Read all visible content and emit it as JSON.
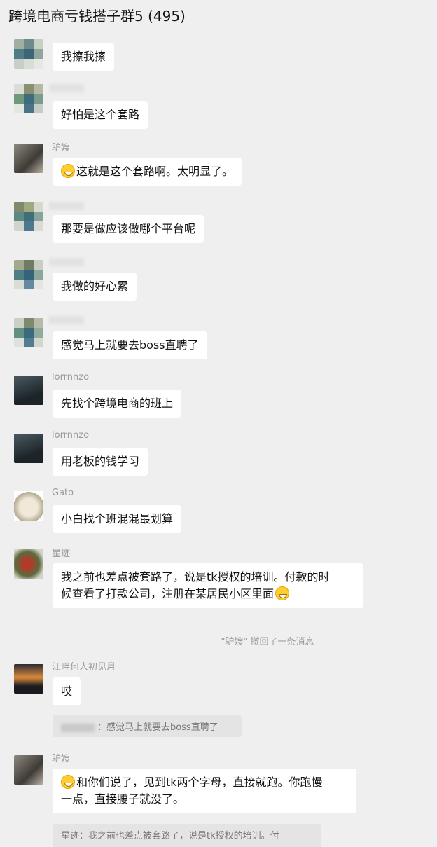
{
  "header": {
    "title": "跨境电商亏钱搭子群5 (495)"
  },
  "messages": [
    {
      "text": "我擦我擦"
    },
    {
      "text": "好怕是这个套路"
    },
    {
      "sender": "驴嫂",
      "text": "这就是这个套路啊。太明显了。",
      "emoji": "grinning-sweat-emoji"
    },
    {
      "text": "那要是做应该做哪个平台呢"
    },
    {
      "text": "我做的好心累"
    },
    {
      "text": "感觉马上就要去boss直聘了"
    },
    {
      "sender": "lorrnnzo",
      "text": "先找个跨境电商的班上"
    },
    {
      "sender": "lorrnnzo",
      "text": "用老板的钱学习"
    },
    {
      "sender": "Gato",
      "text": "小白找个班混混最划算"
    },
    {
      "sender": "星迹",
      "text_line1": "我之前也差点被套路了，说是tk授权的培训。付款的时",
      "text_line2": "候查看了打款公司，注册在某居民小区里面"
    }
  ],
  "system_notice": "\"驴嫂\" 撤回了一条消息",
  "messages2": [
    {
      "sender": "江畔何人初见月",
      "text": "哎",
      "quote": "：感觉马上就要去boss直聘了"
    },
    {
      "sender": "驴嫂",
      "text_line1": "和你们说了，见到tk两个字母，直接就跑。你跑慢",
      "text_line2": "一点，直接腰子就没了。",
      "quote": "星迹：我之前也差点被套路了，说是tk授权的培训。付"
    }
  ]
}
